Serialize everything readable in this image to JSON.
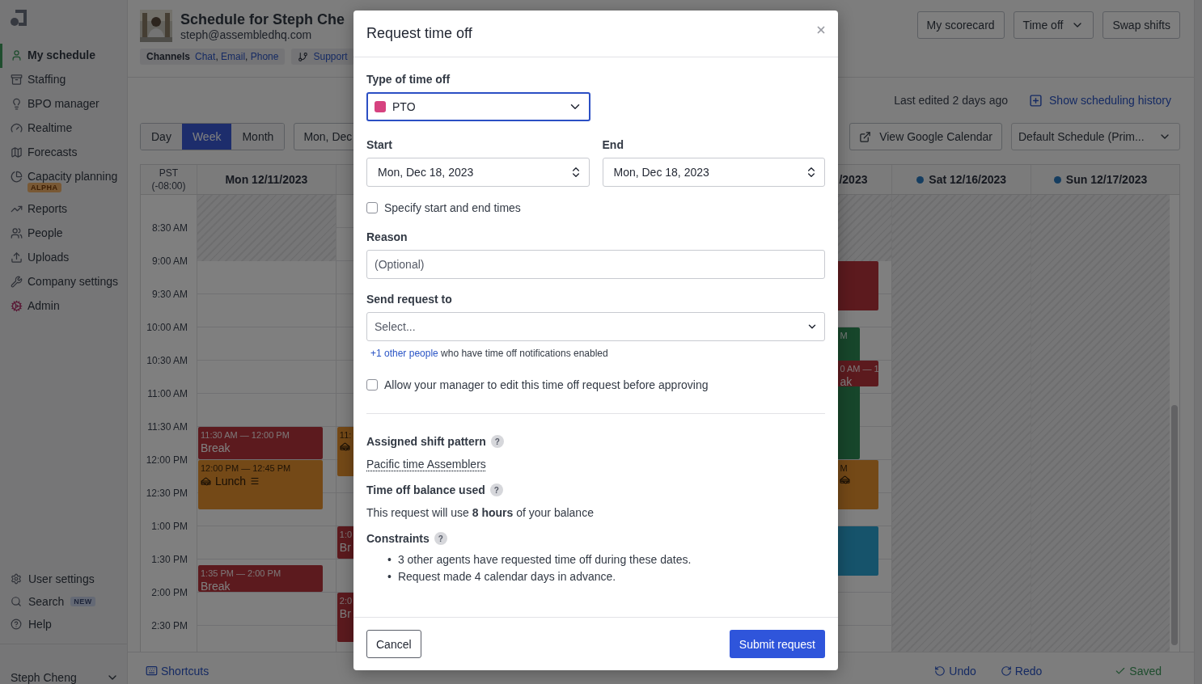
{
  "sidebar": {
    "items": [
      {
        "label": "My schedule",
        "selected": true
      },
      {
        "label": "Staffing",
        "selected": false
      },
      {
        "label": "BPO manager",
        "selected": false
      },
      {
        "label": "Realtime",
        "selected": false
      },
      {
        "label": "Forecasts",
        "selected": false
      },
      {
        "label": "Capacity planning",
        "selected": false,
        "badge": "ALPHA"
      },
      {
        "label": "Reports",
        "selected": false
      },
      {
        "label": "People",
        "selected": false
      },
      {
        "label": "Uploads",
        "selected": false
      },
      {
        "label": "Company settings",
        "selected": false
      },
      {
        "label": "Admin",
        "selected": false
      }
    ],
    "footer_items": [
      {
        "label": "User settings"
      },
      {
        "label": "Search",
        "badge": "NEW"
      },
      {
        "label": "Help"
      }
    ],
    "user": "Steph Cheng"
  },
  "header": {
    "title": "Schedule for Steph Che",
    "email": "steph@assembledhq.com",
    "channels_label": "Channels",
    "channels": [
      "Chat",
      "Email",
      "Phone"
    ],
    "channel_separator": ",",
    "support": "Support",
    "actions": [
      {
        "label": "My scorecard",
        "kind": "button"
      },
      {
        "label": "Time off",
        "kind": "dropdown"
      },
      {
        "label": "Swap shifts",
        "kind": "button"
      }
    ]
  },
  "toolbar": {
    "last_edited": "Last edited 2 days ago",
    "history_link": "Show scheduling history",
    "views": [
      {
        "label": "Day",
        "selected": false
      },
      {
        "label": "Week",
        "selected": true
      },
      {
        "label": "Month",
        "selected": false
      }
    ],
    "date_button": "Mon, Dec",
    "calendar_button": "View Google Calendar",
    "schedule_select": "Default Schedule (Prim..."
  },
  "calendar": {
    "timezone": "PST",
    "offset": "(-08:00)",
    "times": [
      "8:30 AM",
      "9:00 AM",
      "9:30 AM",
      "10:00 AM",
      "10:30 AM",
      "11:00 AM",
      "11:30 AM",
      "12:00 PM",
      "12:30 PM",
      "1:00 PM",
      "1:30 PM",
      "2:00 PM",
      "2:30 PM"
    ],
    "days": [
      {
        "label": "Mon 12/11/2023",
        "dot": false,
        "clipped": false
      },
      {
        "label": "/2023",
        "dot": false,
        "clipped": true
      },
      {
        "label": "Sat 12/16/2023",
        "dot": true,
        "clipped": false
      },
      {
        "label": "Sun 12/17/2023",
        "dot": true,
        "clipped": false
      }
    ],
    "events": [
      {
        "kind": "break",
        "time": "11:30 AM — 12:00 PM",
        "title": "Break"
      },
      {
        "kind": "lunch",
        "time": "12:00 PM — 12:45 PM",
        "title": "Lunch"
      },
      {
        "kind": "break",
        "time": "1:35 PM — 2:00 PM",
        "title": "Break"
      },
      {
        "kind": "lunch",
        "time": "11:"
      },
      {
        "kind": "break",
        "time": "1:0",
        "title": "Br"
      },
      {
        "kind": "break",
        "time": "2:0",
        "title": "Br"
      },
      {
        "kind": "break"
      },
      {
        "kind": "shift",
        "time": "M"
      },
      {
        "kind": "break",
        "time": "0 AM — 1",
        "title": "ak"
      },
      {
        "kind": "lunch",
        "time": "M"
      },
      {
        "kind": "meeting"
      }
    ]
  },
  "footer": {
    "shortcuts": "Shortcuts",
    "undo": "Undo",
    "redo": "Redo",
    "saved": "Saved"
  },
  "modal": {
    "title": "Request time off",
    "type_label": "Type of time off",
    "type_value": "PTO",
    "type_focused": true,
    "start_label": "Start",
    "start_value": "Mon, Dec 18, 2023",
    "end_label": "End",
    "end_value": "Mon, Dec 18, 2023",
    "specify_times": {
      "label": "Specify start and end times",
      "checked": false
    },
    "reason_label": "Reason",
    "reason_placeholder": "(Optional)",
    "send_label": "Send request to",
    "send_placeholder": "Select...",
    "notify_link": "+1 other people",
    "notify_text": "who have time off notifications enabled",
    "allow_edit": {
      "label": "Allow your manager to edit this time off request before approving",
      "checked": false
    },
    "sections": [
      {
        "heading": "Assigned shift pattern",
        "help": "?",
        "kind": "link",
        "text": "Pacific time Assemblers"
      },
      {
        "heading": "Time off balance used",
        "help": "?",
        "kind": "text",
        "text": "This request will use **8 hours** of your balance"
      },
      {
        "heading": "Constraints",
        "help": "?",
        "kind": "list",
        "bullet": "•",
        "items": [
          "3 other agents have requested time off during these dates.",
          "Request made 4 calendar days in advance."
        ]
      }
    ],
    "cancel": "Cancel",
    "submit": "Submit request"
  }
}
